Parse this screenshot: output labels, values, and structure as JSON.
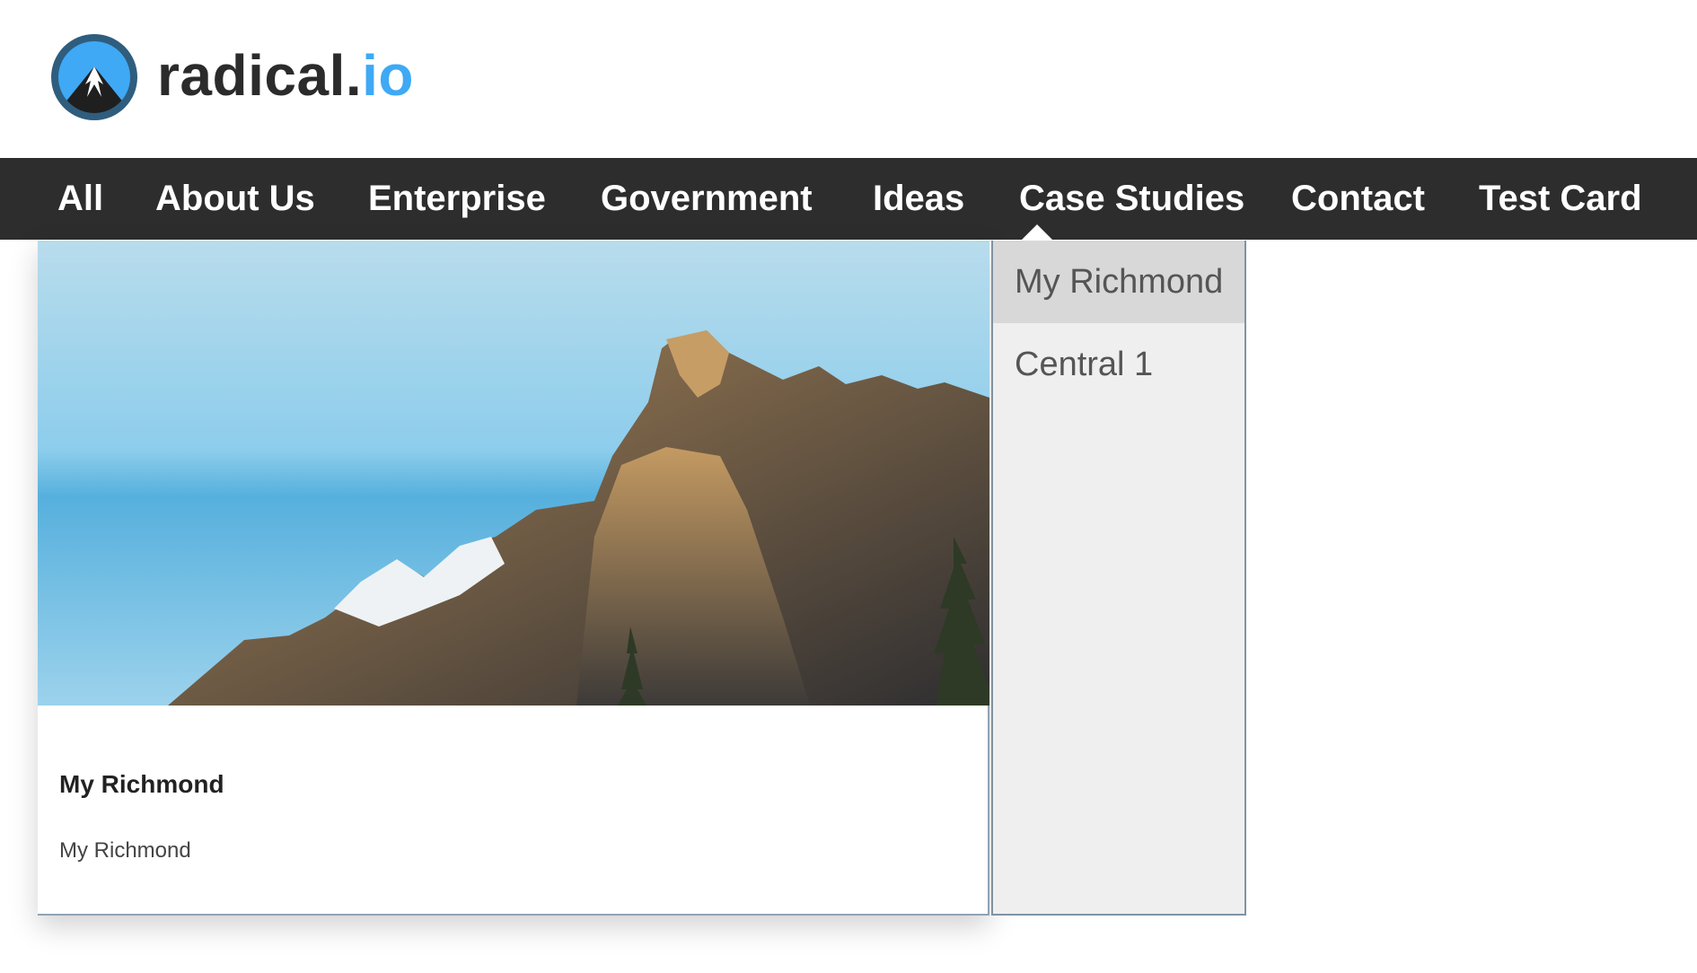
{
  "brand": {
    "name": "radical",
    "dot": ".",
    "tld": "io"
  },
  "nav": {
    "items": [
      {
        "label": "All"
      },
      {
        "label": "About Us"
      },
      {
        "label": "Enterprise"
      },
      {
        "label": "Government"
      },
      {
        "label": "Ideas"
      },
      {
        "label": "Case Studies"
      },
      {
        "label": "Contact"
      },
      {
        "label": "Test Card"
      }
    ],
    "active": "Case Studies"
  },
  "card": {
    "title": "My Richmond",
    "description": "My Richmond"
  },
  "dropdown": {
    "items": [
      {
        "label": "My Richmond",
        "highlighted": true
      },
      {
        "label": "Central 1",
        "highlighted": false
      }
    ]
  },
  "colors": {
    "nav_bg": "#2d2d2d",
    "brand_accent": "#3fa9f5",
    "dropdown_bg": "#efefef",
    "dropdown_highlight": "#d8d8d8"
  }
}
